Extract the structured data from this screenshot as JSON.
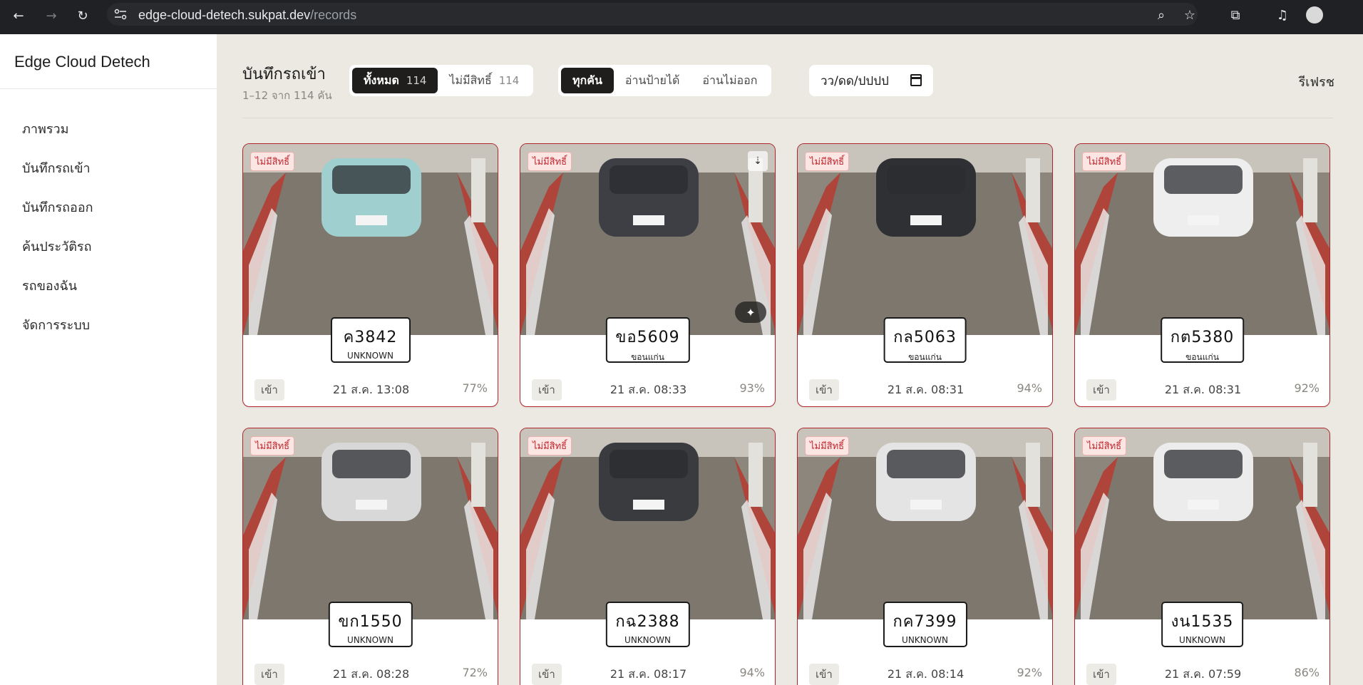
{
  "browser": {
    "url_host": "edge-cloud-detech.sukpat.dev",
    "url_path": "/records"
  },
  "sidebar": {
    "brand": "Edge Cloud Detech",
    "items": [
      {
        "label": "ภาพรวม"
      },
      {
        "label": "บันทึกรถเข้า"
      },
      {
        "label": "บันทึกรถออก"
      },
      {
        "label": "ค้นประวัติรถ"
      },
      {
        "label": "รถของฉัน"
      },
      {
        "label": "จัดการระบบ"
      }
    ]
  },
  "header": {
    "title": "บันทึกรถเข้า",
    "subtitle": "1–12 จาก 114 คัน",
    "filter_access": [
      {
        "label": "ทั้งหมด",
        "count": "114",
        "active": true
      },
      {
        "label": "ไม่มีสิทธิ์",
        "count": "114",
        "active": false
      }
    ],
    "filter_read": [
      {
        "label": "ทุกคัน",
        "active": true
      },
      {
        "label": "อ่านป้ายได้",
        "active": false
      },
      {
        "label": "อ่านไม่ออก",
        "active": false
      }
    ],
    "date_placeholder": "วว/ดด/ปปปป",
    "refresh_label": "รีเฟรช"
  },
  "records": [
    {
      "badge": "ไม่มีสิทธิ์",
      "plate": "ค3842",
      "province": "UNKNOWN",
      "direction": "เข้า",
      "time": "21 ส.ค. 13:08",
      "confidence": "77%",
      "car_color": "#9fd0cf"
    },
    {
      "badge": "ไม่มีสิทธิ์",
      "plate": "ขอ5609",
      "province": "ขอนแก่น",
      "direction": "เข้า",
      "time": "21 ส.ค. 08:33",
      "confidence": "93%",
      "car_color": "#3d3f44"
    },
    {
      "badge": "ไม่มีสิทธิ์",
      "plate": "กล5063",
      "province": "ขอนแก่น",
      "direction": "เข้า",
      "time": "21 ส.ค. 08:31",
      "confidence": "94%",
      "car_color": "#2f3034"
    },
    {
      "badge": "ไม่มีสิทธิ์",
      "plate": "กต5380",
      "province": "ขอนแก่น",
      "direction": "เข้า",
      "time": "21 ส.ค. 08:31",
      "confidence": "92%",
      "car_color": "#eeeeee"
    },
    {
      "badge": "ไม่มีสิทธิ์",
      "plate": "ขก1550",
      "province": "UNKNOWN",
      "direction": "เข้า",
      "time": "21 ส.ค. 08:28",
      "confidence": "72%",
      "car_color": "#d8d8d8"
    },
    {
      "badge": "ไม่มีสิทธิ์",
      "plate": "กฉ2388",
      "province": "UNKNOWN",
      "direction": "เข้า",
      "time": "21 ส.ค. 08:17",
      "confidence": "94%",
      "car_color": "#3a3b3f"
    },
    {
      "badge": "ไม่มีสิทธิ์",
      "plate": "กค7399",
      "province": "UNKNOWN",
      "direction": "เข้า",
      "time": "21 ส.ค. 08:14",
      "confidence": "92%",
      "car_color": "#e4e4e4"
    },
    {
      "badge": "ไม่มีสิทธิ์",
      "plate": "งน1535",
      "province": "UNKNOWN",
      "direction": "เข้า",
      "time": "21 ส.ค. 07:59",
      "confidence": "86%",
      "car_color": "#ececec"
    }
  ]
}
